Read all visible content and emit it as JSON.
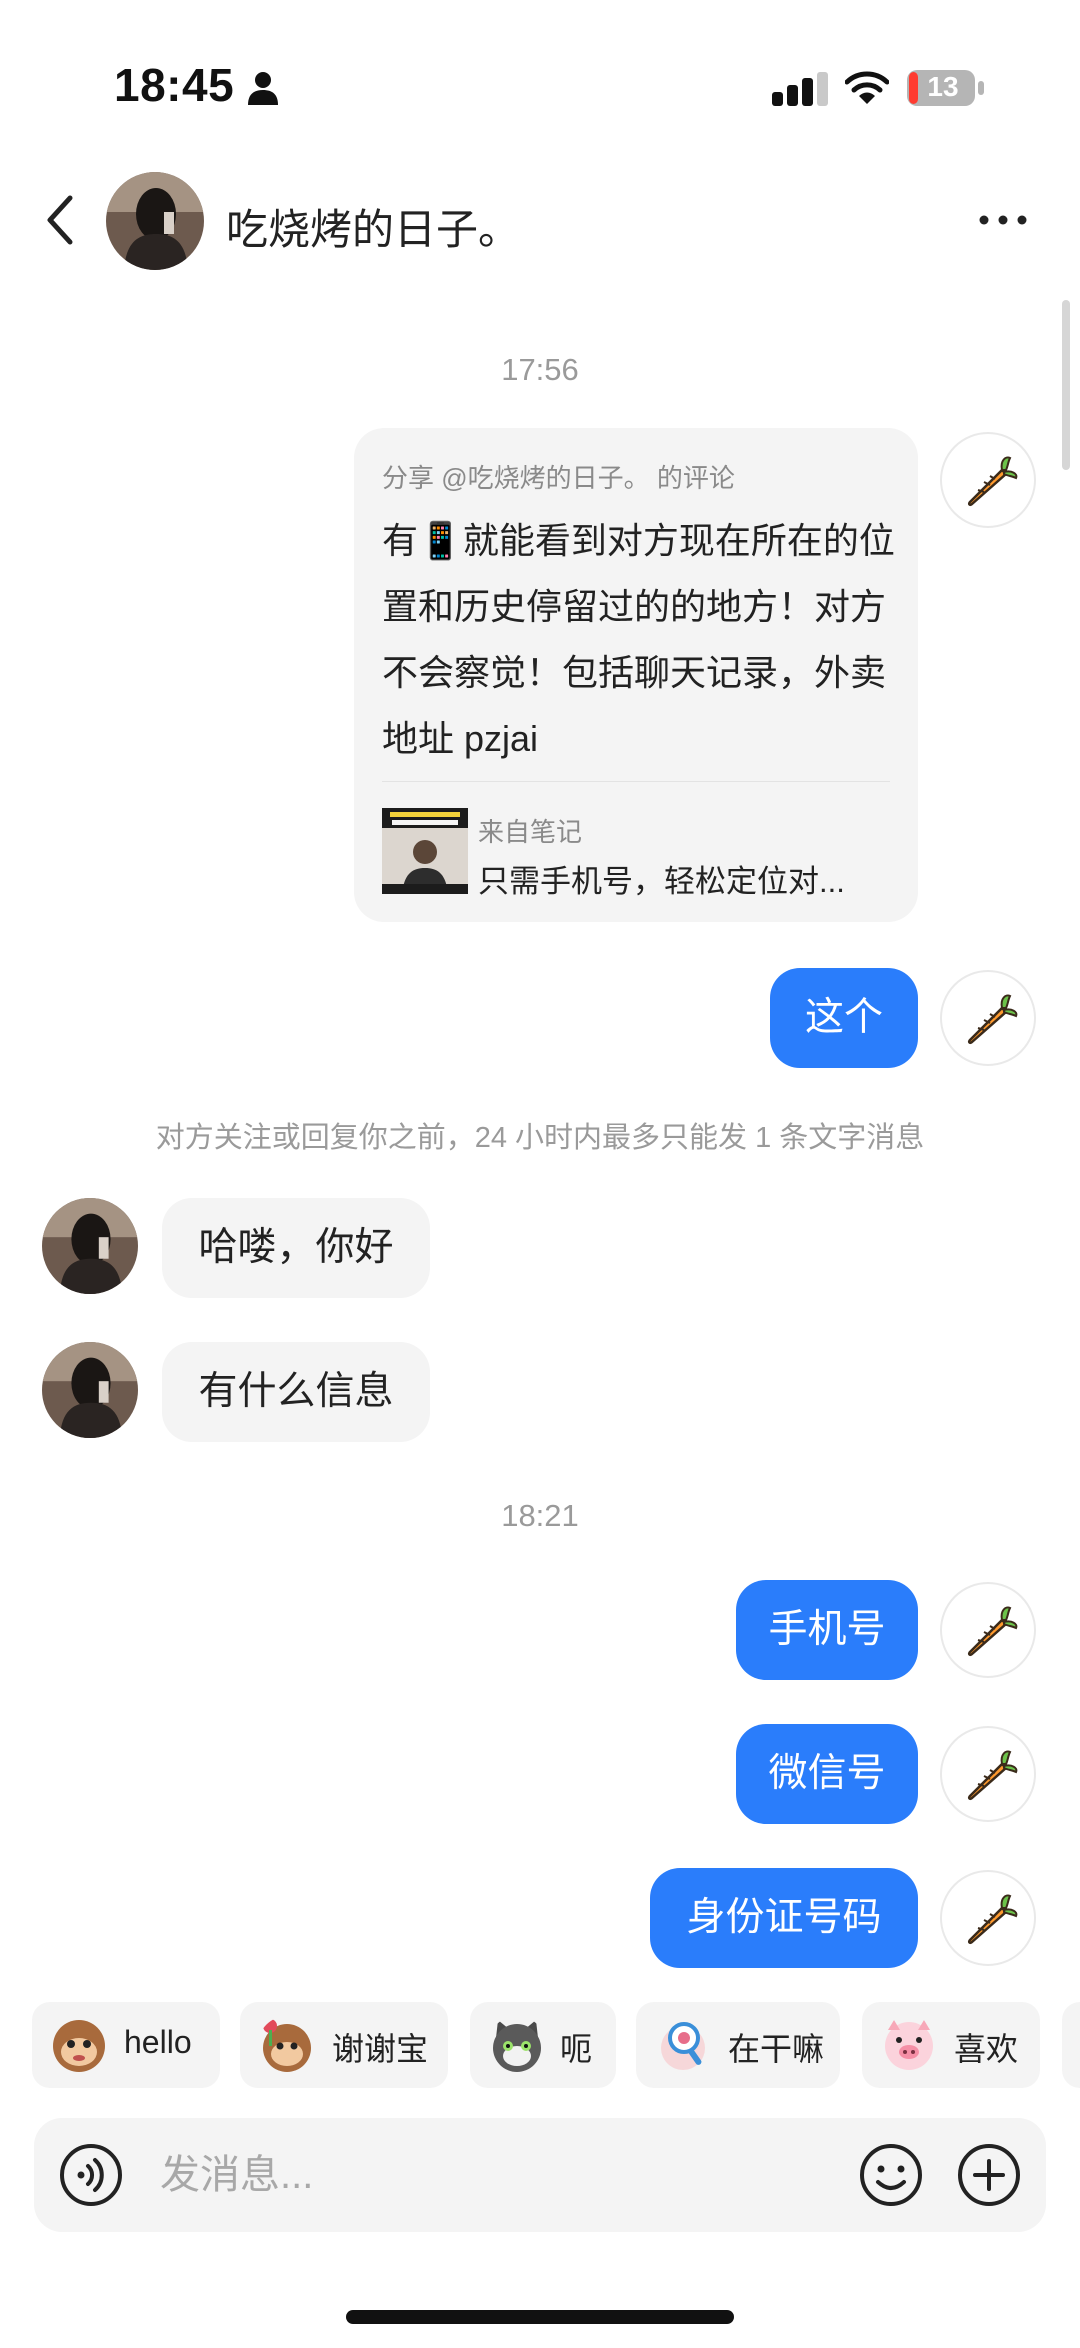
{
  "status_bar": {
    "time": "18:45",
    "battery_level": "13"
  },
  "header": {
    "contact_name": "吃烧烤的日子。"
  },
  "messages": {
    "timestamp_1": "17:56",
    "share_card": {
      "meta": "分享 @吃烧烤的日子。 的评论",
      "text": "有📱就能看到对方现在所在的位置和历史停留过的的地方！对方不会察觉！包括聊天记录，外卖地址 pzjai",
      "from_label": "来自笔记",
      "note_title": "只需手机号，轻松定位对..."
    },
    "out_1": "这个",
    "notice": "对方关注或回复你之前，24 小时内最多只能发 1 条文字消息",
    "in_1": "哈喽，你好",
    "in_2": "有什么信息",
    "timestamp_2": "18:21",
    "out_2": "手机号",
    "out_3": "微信号",
    "out_4": "身份证号码"
  },
  "quick_replies": [
    {
      "label": "hello",
      "sticker": "monkey-sticker"
    },
    {
      "label": "谢谢宝",
      "sticker": "monkey-flower-sticker"
    },
    {
      "label": "呃",
      "sticker": "cat-sticker"
    },
    {
      "label": "在干嘛",
      "sticker": "magnifier-sticker"
    },
    {
      "label": "喜欢",
      "sticker": "pig-sticker"
    }
  ],
  "composer": {
    "placeholder": "发消息..."
  },
  "colors": {
    "accent": "#2a7dfb",
    "bubble_in": "#f4f4f4",
    "muted_text": "#9a9a9a"
  }
}
